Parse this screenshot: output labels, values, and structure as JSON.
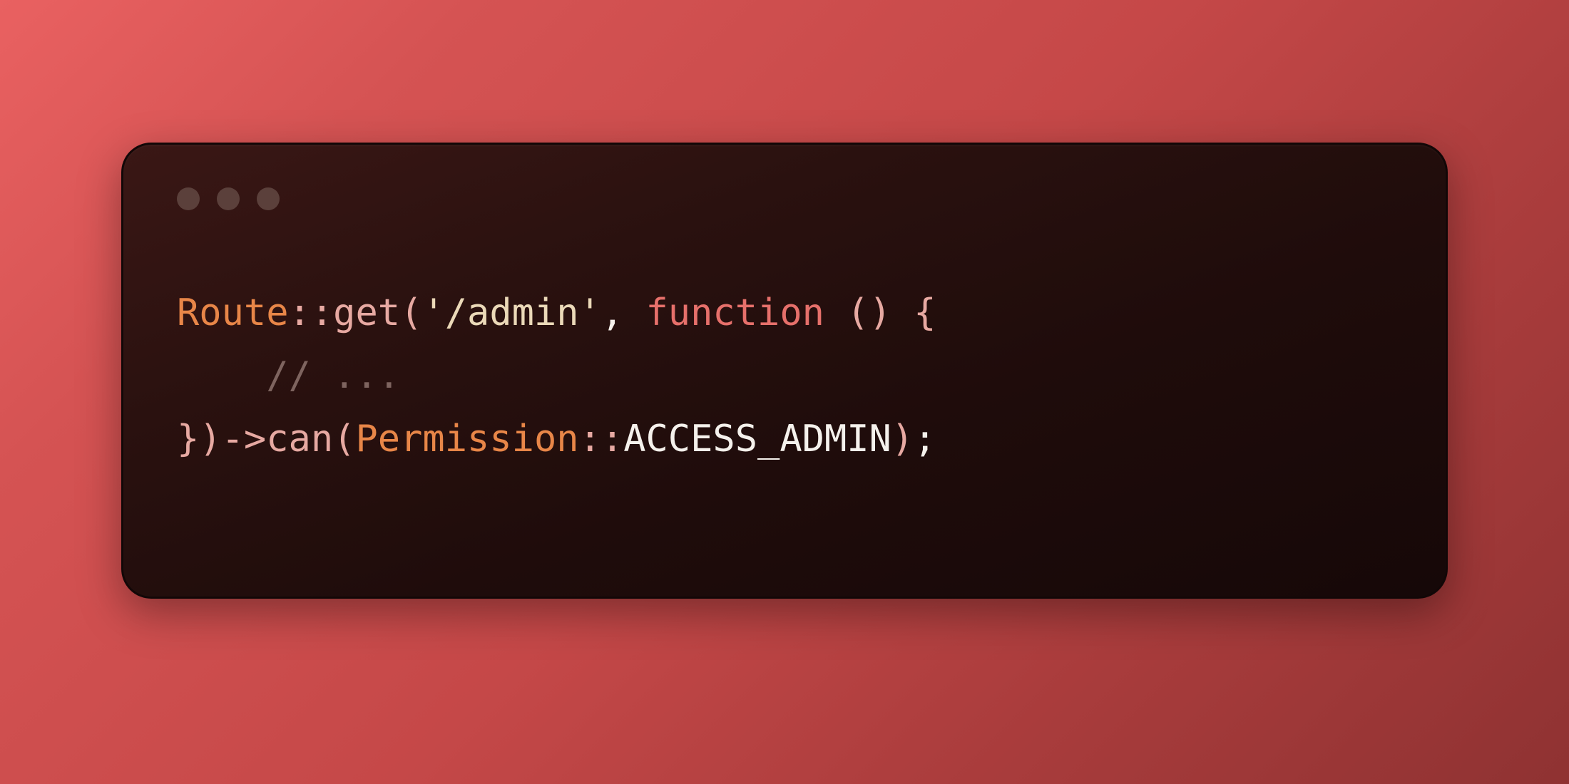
{
  "colors": {
    "bg_gradient_from": "#e96161",
    "bg_gradient_to": "#8f3232",
    "window_bg_from": "#3a1715",
    "window_bg_to": "#160808",
    "dot": "#5b403b",
    "class": "#e88648",
    "operator": "#e7a9a2",
    "method": "#e7a9a2",
    "paren": "#e7a9a2",
    "string": "#ebd9b8",
    "keyword": "#e6706b",
    "plain": "#f5f1ec",
    "comment": "#7e645f"
  },
  "code": {
    "line1": {
      "t1": "Route",
      "t2": "::",
      "t3": "get",
      "t4": "(",
      "t5": "'/admin'",
      "t6": ", ",
      "t7": "function",
      "t8": " ",
      "t9": "()",
      "t10": " ",
      "t11": "{"
    },
    "line2": {
      "indent": "    ",
      "t1": "// ..."
    },
    "line3": {
      "t1": "}",
      "t2": ")",
      "t3": "->",
      "t4": "can",
      "t5": "(",
      "t6": "Permission",
      "t7": "::",
      "t8": "ACCESS_ADMIN",
      "t9": ")",
      "t10": ";"
    }
  }
}
